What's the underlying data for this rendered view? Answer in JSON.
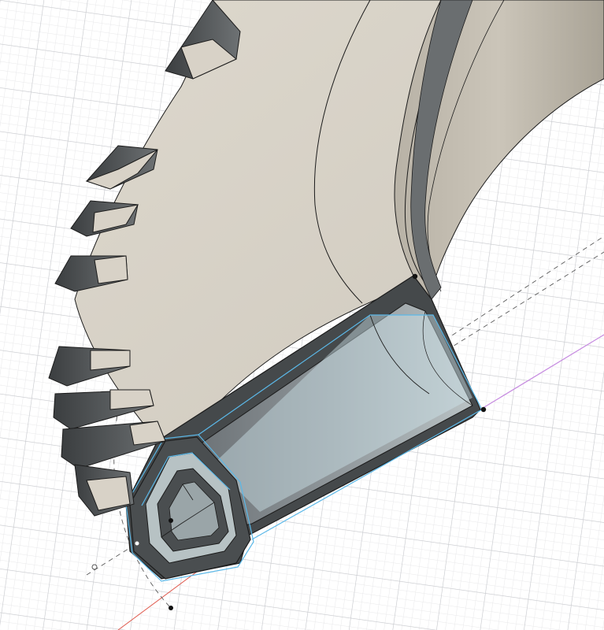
{
  "app": {
    "view": "3d-model-viewport",
    "icons": [
      "sketch-point-icon"
    ]
  },
  "colors": {
    "background": "#ffffff",
    "grid_minor": "#e8e8ea",
    "grid_major": "#c9cbcf",
    "body_face": "#d6d0c5",
    "body_face_shadow": "#b8b1a5",
    "body_dark": "#55585a",
    "body_darker": "#3f4244",
    "edge": "#1c1c1c",
    "sketch_profile": "#5bb8e8",
    "sketch_fill": "#cfe4ec",
    "construction_line": "#5a5a5a",
    "x_axis": "#e05a4e",
    "z_axis": "#c68ae0",
    "point": "#111111"
  }
}
